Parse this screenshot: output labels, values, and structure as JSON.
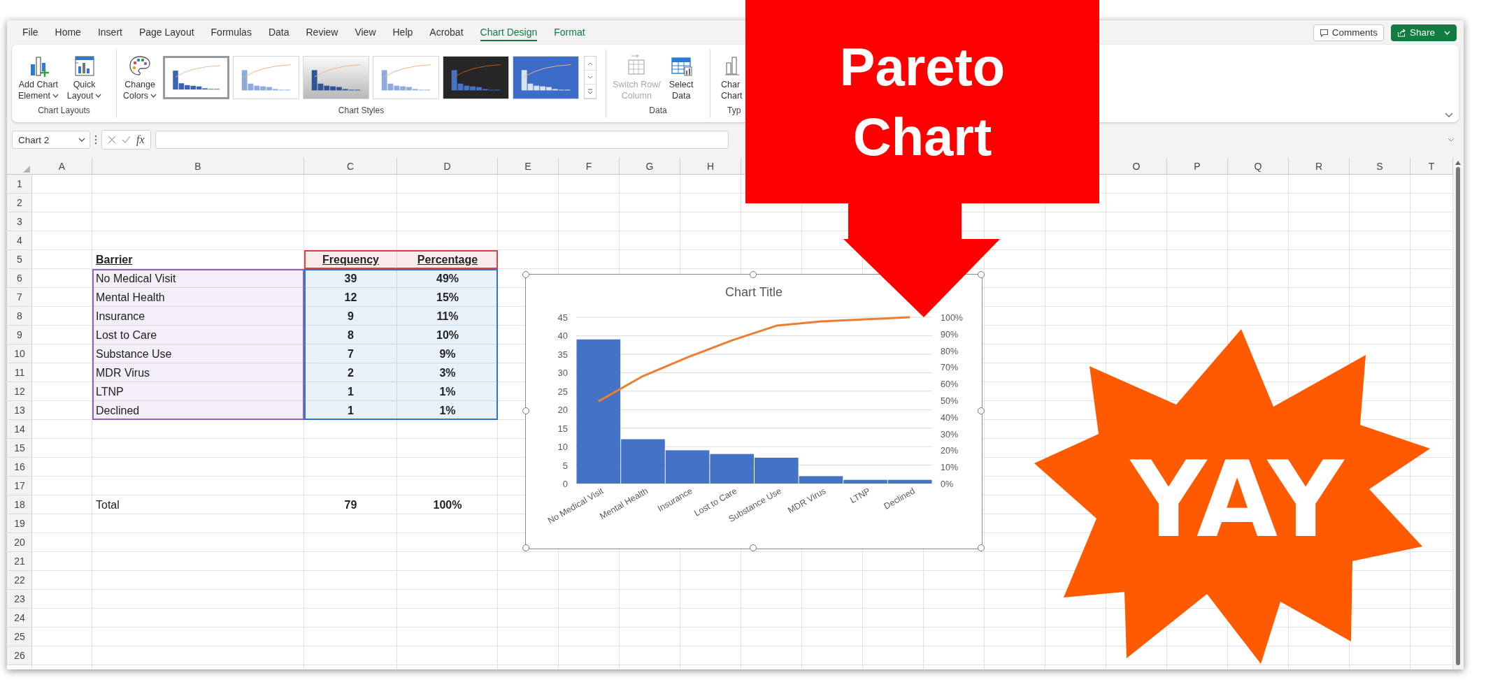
{
  "ribbon_tabs": [
    {
      "label": "File",
      "selected": false,
      "contextual": false
    },
    {
      "label": "Home",
      "selected": false,
      "contextual": false
    },
    {
      "label": "Insert",
      "selected": false,
      "contextual": false
    },
    {
      "label": "Page Layout",
      "selected": false,
      "contextual": false
    },
    {
      "label": "Formulas",
      "selected": false,
      "contextual": false
    },
    {
      "label": "Data",
      "selected": false,
      "contextual": false
    },
    {
      "label": "Review",
      "selected": false,
      "contextual": false
    },
    {
      "label": "View",
      "selected": false,
      "contextual": false
    },
    {
      "label": "Help",
      "selected": false,
      "contextual": false
    },
    {
      "label": "Acrobat",
      "selected": false,
      "contextual": false
    },
    {
      "label": "Chart Design",
      "selected": true,
      "contextual": true
    },
    {
      "label": "Format",
      "selected": false,
      "contextual": true
    }
  ],
  "header_buttons": [
    {
      "kind": "comments",
      "label": "Comments",
      "dropdown": false
    },
    {
      "kind": "share",
      "label": "Share",
      "dropdown": true
    }
  ],
  "ribbon_groups": [
    {
      "label": "Chart Layouts",
      "buttons": [
        {
          "kind": "add_element",
          "lines": [
            "Add Chart",
            "Element"
          ],
          "dropdown": true,
          "disabled": false
        },
        {
          "kind": "quick_layout",
          "lines": [
            "Quick",
            "Layout"
          ],
          "dropdown": true,
          "disabled": false
        }
      ]
    },
    {
      "label": "Chart Styles",
      "buttons": [
        {
          "kind": "change_colors",
          "lines": [
            "Change",
            "Colors"
          ],
          "dropdown": true,
          "disabled": false
        }
      ],
      "styles": [
        {
          "kind": "white",
          "selected": true
        },
        {
          "kind": "pale",
          "selected": false
        },
        {
          "kind": "gray",
          "selected": false
        },
        {
          "kind": "pale",
          "selected": false
        },
        {
          "kind": "dark",
          "selected": false
        },
        {
          "kind": "blue",
          "selected": false
        }
      ]
    },
    {
      "label": "Data",
      "buttons": [
        {
          "kind": "switch",
          "lines": [
            "Switch Row/",
            "Column"
          ],
          "dropdown": false,
          "disabled": true
        },
        {
          "kind": "select",
          "lines": [
            "Select",
            "Data"
          ],
          "dropdown": false,
          "disabled": false
        }
      ]
    },
    {
      "label": "Typ",
      "buttons": [
        {
          "kind": "type",
          "lines": [
            "Char",
            "Chart"
          ],
          "dropdown": false,
          "disabled": false
        }
      ]
    }
  ],
  "formula_bar": {
    "name_box": "Chart 2",
    "function_label": "fx"
  },
  "sheet": {
    "column_headers": [
      "A",
      "B",
      "C",
      "D",
      "E",
      "F",
      "G",
      "H",
      "O",
      "P",
      "Q",
      "R",
      "S",
      "T"
    ],
    "row_headers": [
      "1",
      "2",
      "3",
      "4",
      "5",
      "6",
      "7",
      "8",
      "9",
      "10",
      "11",
      "12",
      "13",
      "14",
      "15",
      "16",
      "17",
      "18",
      "19",
      "20",
      "21",
      "22",
      "23",
      "24",
      "25",
      "26"
    ],
    "table": {
      "columns": [
        "Barrier",
        "Frequency",
        "Percentage"
      ],
      "rows": [
        [
          "No Medical Visit",
          "39",
          "49%"
        ],
        [
          "Mental Health",
          "12",
          "15%"
        ],
        [
          "Insurance",
          "9",
          "11%"
        ],
        [
          "Lost to Care",
          "8",
          "10%"
        ],
        [
          "Substance Use",
          "7",
          "9%"
        ],
        [
          "MDR Virus",
          "2",
          "3%"
        ],
        [
          "LTNP",
          "1",
          "1%"
        ],
        [
          "Declined",
          "1",
          "1%"
        ]
      ],
      "total": [
        "Total",
        "79",
        "100%"
      ]
    },
    "source_ranges": [
      {
        "kind": "categories",
        "color": "#8e63b8"
      },
      {
        "kind": "values",
        "color": "#2e75c7"
      },
      {
        "kind": "series_name",
        "color": "#d04545"
      }
    ]
  },
  "chart": {
    "chart_data": {
      "type": "bar",
      "title": "Chart Title",
      "categories": [
        "No Medical Visit",
        "Mental Health",
        "Insurance",
        "Lost to Care",
        "Substance Use",
        "MDR Virus",
        "LTNP",
        "Declined"
      ],
      "series": [
        {
          "type": "bar",
          "color": "#4472c4",
          "values": [
            39,
            12,
            9,
            8,
            7,
            2,
            1,
            1
          ]
        },
        {
          "type": "line",
          "axis": "y2",
          "color": "#ed7d31",
          "values": [
            49.4,
            64.6,
            75.9,
            86.1,
            94.9,
            97.5,
            98.7,
            100
          ]
        }
      ],
      "grid": true,
      "ylim": [
        0,
        45
      ],
      "yticks": [
        0,
        5,
        10,
        15,
        20,
        25,
        30,
        35,
        40,
        45
      ],
      "y2lim": [
        0,
        100
      ],
      "y2ticks": [
        {
          "value": 0,
          "label": "0%"
        },
        {
          "value": 10,
          "label": "10%"
        },
        {
          "value": 20,
          "label": "20%"
        },
        {
          "value": 30,
          "label": "30%"
        },
        {
          "value": 40,
          "label": "40%"
        },
        {
          "value": 50,
          "label": "50%"
        },
        {
          "value": 60,
          "label": "60%"
        },
        {
          "value": 70,
          "label": "70%"
        },
        {
          "value": 80,
          "label": "80%"
        },
        {
          "value": 90,
          "label": "90%"
        },
        {
          "value": 100,
          "label": "100%"
        }
      ]
    }
  },
  "callout": {
    "text": "Pareto Chart"
  },
  "badge": {
    "text": "YAY"
  }
}
